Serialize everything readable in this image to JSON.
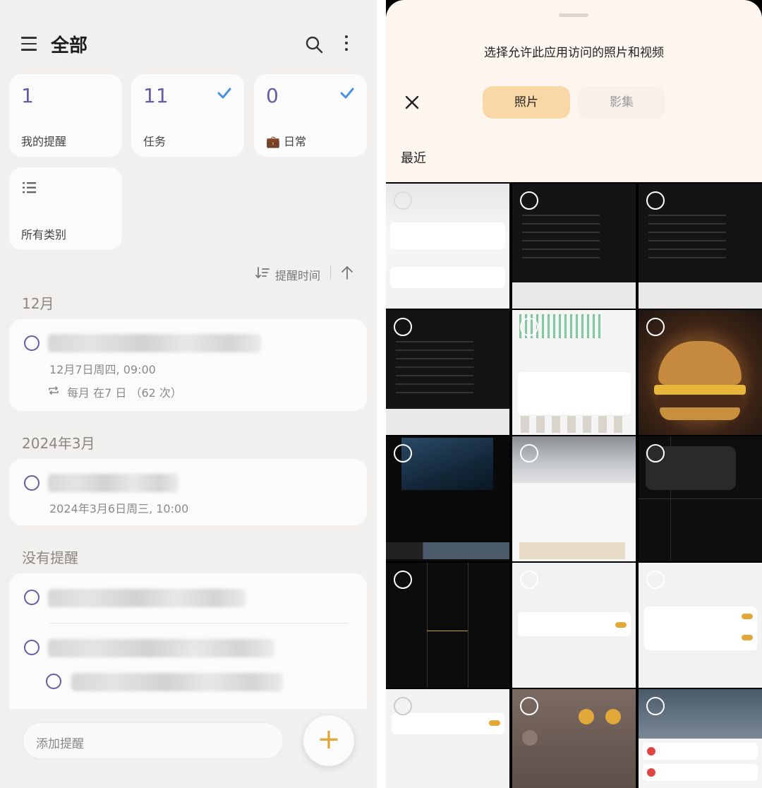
{
  "left": {
    "title": "全部",
    "cards": [
      {
        "count": "1",
        "label": "我的提醒"
      },
      {
        "count": "11",
        "label": "任务"
      },
      {
        "count": "0",
        "label": "💼 日常"
      },
      {
        "label": "所有类别"
      }
    ],
    "sort_label": "提醒时间",
    "groups": [
      {
        "title": "12月",
        "date": "12月7日周四, 09:00",
        "repeat": "每月 在7 日 （62 次）"
      },
      {
        "title": "2024年3月",
        "date": "2024年3月6日周三, 10:00"
      },
      {
        "title": "没有提醒"
      }
    ],
    "add_placeholder": "添加提醒",
    "fab_icon": "+"
  },
  "right": {
    "sheet_title": "选择允许此应用访问的照片和视频",
    "tabs": [
      "照片",
      "影集"
    ],
    "section": "最近",
    "thumbnails": [
      "screenshot-reminders",
      "screenshot-dark-notes",
      "screenshot-dark-notes",
      "screenshot-dark-notes",
      "screenshot-battery-chart",
      "photo-burger",
      "photo-night-sky-video",
      "screenshot-photo-details",
      "screenshot-camera-fhd",
      "screenshot-camera-grid",
      "screenshot-settings",
      "screenshot-camera-settings",
      "screenshot-toggle-settings",
      "screenshot-control-center",
      "screenshot-music-notifications"
    ]
  },
  "colors": {
    "accent": "#6a5aa6",
    "fab": "#e2a83a",
    "tab_selected": "#f9d7a7"
  }
}
